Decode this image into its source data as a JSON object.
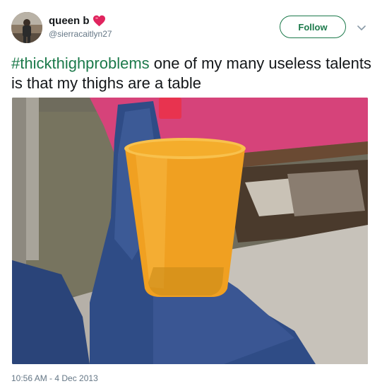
{
  "user": {
    "display_name": "queen b",
    "handle": "@sierracaitlyn27"
  },
  "actions": {
    "follow_label": "Follow"
  },
  "tweet": {
    "hashtag": "#thickthighproblems",
    "text": " one of my many useless talents is that my thighs are a table",
    "timestamp": "10:56 AM - 4 Dec 2013"
  },
  "colors": {
    "accent_green": "#1c7a4b",
    "heart": "#e0245e",
    "secondary_text": "#657786"
  },
  "icons": {
    "heart": "heart-icon",
    "caret": "chevron-down-icon",
    "avatar": "avatar"
  }
}
